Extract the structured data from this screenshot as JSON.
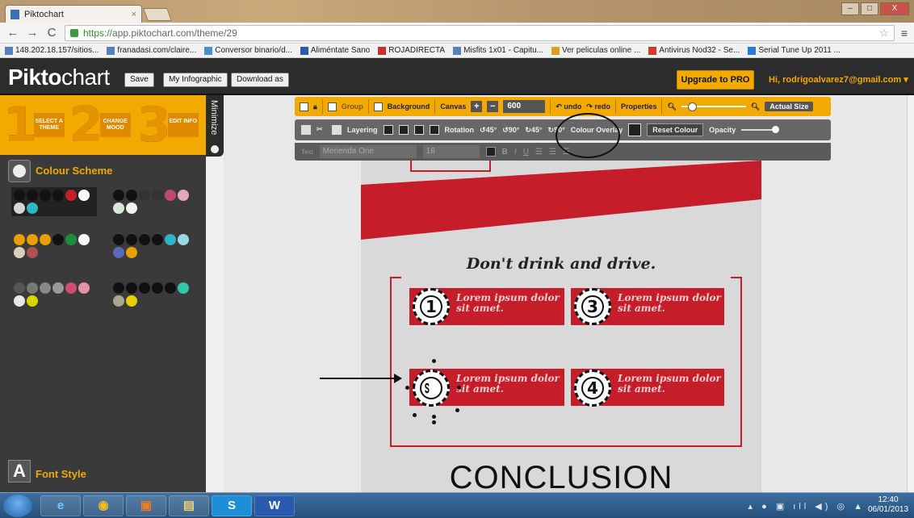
{
  "browser": {
    "tab_title": "Piktochart",
    "tab_close": "×",
    "url_scheme": "https://",
    "url_rest": "app.piktochart.com/theme/29",
    "window_controls": [
      "–",
      "□",
      "X"
    ],
    "bookmarks": [
      {
        "label": "148.202.18.157/sitios..."
      },
      {
        "label": "franadasi.com/claire..."
      },
      {
        "label": "Conversor binario/d..."
      },
      {
        "label": "Aliméntate Sano"
      },
      {
        "label": "ROJADIRECTA"
      },
      {
        "label": "Misfits 1x01 - Capitu..."
      },
      {
        "label": "Ver peliculas online ..."
      },
      {
        "label": "Antivirus Nod32 - Se..."
      },
      {
        "label": "Serial Tune Up 2011 ..."
      }
    ]
  },
  "header": {
    "logo_bold": "Pikto",
    "logo_light": "chart",
    "save": "Save",
    "my_infographic": "My Infographic",
    "download": "Download as",
    "upgrade": "Upgrade to PRO",
    "user": "Hi, rodrigoalvarez7@gmail.com ▾"
  },
  "steps": [
    {
      "num": "1",
      "label": "SELECT A THEME"
    },
    {
      "num": "2",
      "label": "CHANGE MOOD"
    },
    {
      "num": "3",
      "label": "EDIT INFO"
    }
  ],
  "sidebar": {
    "minimize": "Minimize",
    "colour_scheme": "Colour Scheme",
    "font_style": "Font Style",
    "font_icon": "A"
  },
  "palettes": [
    {
      "colors": [
        "#111111",
        "#111111",
        "#111111",
        "#111111",
        "#c41e2a",
        "#ffffff",
        "#d6d6d6",
        "#2fb6c4"
      ]
    },
    {
      "colors": [
        "#111111",
        "#111111",
        "#333333",
        "#333333",
        "#c04a6c",
        "#e4a8b8",
        "#d8e8d8",
        "#f2f2f2"
      ]
    },
    {
      "colors": [
        "#e8a000",
        "#e8a000",
        "#e8a000",
        "#111111",
        "#1c8f3c",
        "#ffffff",
        "#d8d0b8",
        "#b05050"
      ]
    },
    {
      "colors": [
        "#111111",
        "#111111",
        "#111111",
        "#111111",
        "#2fb3c8",
        "#9ad8e0",
        "#5a6ab8",
        "#e8a000"
      ]
    },
    {
      "colors": [
        "#555555",
        "#777777",
        "#888888",
        "#999999",
        "#d04c70",
        "#e890a8",
        "#e8e8e8",
        "#d8d800"
      ]
    },
    {
      "colors": [
        "#111111",
        "#111111",
        "#111111",
        "#111111",
        "#111111",
        "#2fc8a8",
        "#a8a890",
        "#e8d000"
      ]
    }
  ],
  "toolbar1": {
    "group": "Group",
    "background": "Background",
    "canvas": "Canvas",
    "plus": "+",
    "minus": "−",
    "canvas_value": "600",
    "undo": "undo",
    "redo": "redo",
    "properties": "Properties",
    "actual_size": "Actual Size"
  },
  "toolbar2": {
    "layering": "Layering",
    "rotation": "Rotation",
    "r1": "45°",
    "r2": "90°",
    "r3": "45°",
    "r4": "90°",
    "colour_overlay": "Colour Overlay",
    "reset_colour": "Reset Colour",
    "opacity": "Opacity"
  },
  "toolbar3": {
    "text_label": "Text",
    "font": "Merienda One",
    "size": "16",
    "bold": "B",
    "italic": "I",
    "underline": "U"
  },
  "infographic": {
    "headline": "Don't drink and drive.",
    "cards": [
      {
        "num": "1",
        "text": "Lorem ipsum dolor sit amet."
      },
      {
        "num": "3",
        "text": "Lorem ipsum dolor sit amet."
      },
      {
        "num": "ᔥ",
        "text": "Lorem ipsum dolor sit amet."
      },
      {
        "num": "4",
        "text": "Lorem ipsum dolor sit amet."
      }
    ],
    "conclusion": "CONCLUSION"
  },
  "taskbar": {
    "apps": [
      "e",
      "◉",
      "▣",
      "▤",
      "S",
      "W"
    ],
    "time": "12:40",
    "date": "06/01/2013"
  },
  "colors": {
    "accent": "#f2a900",
    "brand_red": "#c51d2a",
    "panel_dark": "#3a3a3a"
  }
}
